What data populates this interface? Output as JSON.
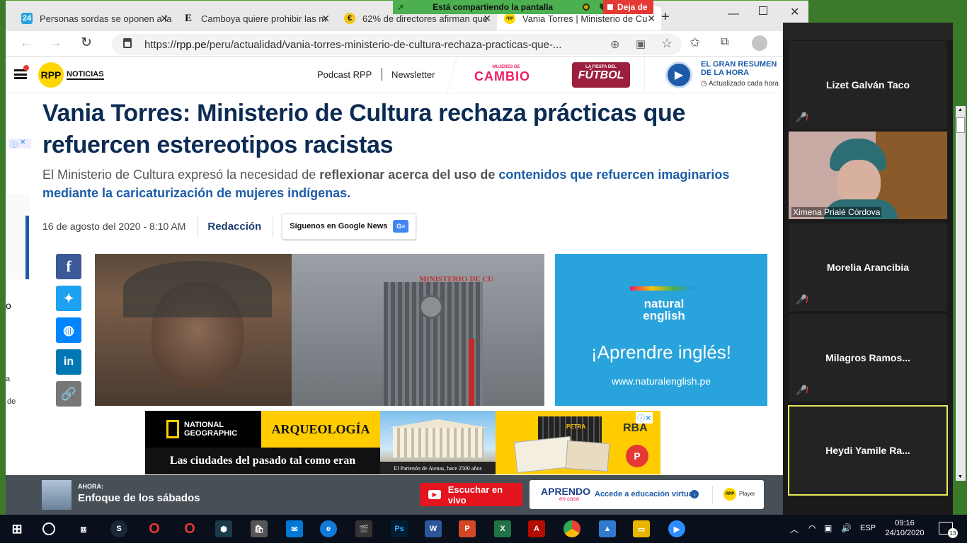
{
  "browser": {
    "tabs": [
      {
        "label": "Personas sordas se oponen a la",
        "favicon": "24"
      },
      {
        "label": "Camboya quiere prohibir las m",
        "favicon": "E"
      },
      {
        "label": "62% de directores afirman que",
        "favicon": "€"
      },
      {
        "label": "Vania Torres | Ministerio de Cu",
        "favicon": "rpp"
      }
    ],
    "url_prefix": "https://",
    "url_domain": "rpp.pe",
    "url_path": "/peru/actualidad/vania-torres-ministerio-de-cultura-rechaza-practicas-que-...",
    "share_banner": "Está compartiendo la pantalla",
    "stop_share": "Deja de"
  },
  "site": {
    "logo": "RPP",
    "logo_text": "NOTICIAS",
    "nav": [
      "Podcast RPP",
      "Newsletter"
    ],
    "brand_cambio_small": "MUJERES DE",
    "brand_cambio": "CAMBIO",
    "brand_futbol_small": "LA FIESTA DEL",
    "brand_futbol": "FÚTBOL",
    "resumen_title": "EL GRAN RESUMEN DE LA HORA",
    "resumen_sub": "Actualizado cada hora"
  },
  "article": {
    "title": "Vania Torres: Ministerio de Cultura rechaza prácticas que refuercen estereotipos racistas",
    "lead_1": "El Ministerio de Cultura expresó la necesidad de ",
    "lead_2": "reflexionar acerca del uso de",
    "lead_3": " ",
    "lead_4": "contenidos que refuercen imaginarios mediante la caricaturización de mujeres indígenas.",
    "date": "16 de agosto del 2020 - 8:10 AM",
    "author": "Redacción",
    "google_news": "Síguenos en Google News",
    "building_sign": "MINISTERIO DE CU"
  },
  "share_icons": [
    "facebook-icon",
    "twitter-icon",
    "messenger-icon",
    "linkedin-icon",
    "link-icon"
  ],
  "ads": {
    "ne_brand": "natural english",
    "ne_slogan": "¡Aprendre inglés!",
    "ne_url": "www.naturalenglish.pe",
    "ng_brand": "NATIONAL GEOGRAPHIC",
    "ng_title": "ARQUEOLOGÍA",
    "ng_tagline": "Las ciudades del pasado tal como eran",
    "ng_caption": "El Partenón de Atenas, hace 2500 años",
    "ng_rba": "RBA",
    "ng_petra": "PETRA"
  },
  "player": {
    "now_label": "AHORA:",
    "now_show": "Enfoque de los sábados",
    "listen_button": "Escuchar en vivo",
    "aprendo": "APRENDO",
    "aprendo_sub": "en casa",
    "aprendo_cta": "Accede a educación virtual",
    "rpp_player": "Player"
  },
  "zoom": {
    "participants": [
      {
        "name": "Lizet Galván Taco",
        "video": false
      },
      {
        "name": "Ximena Prialé Córdova",
        "video": true
      },
      {
        "name": "Morelia Arancibia",
        "video": false
      },
      {
        "name": "Milagros  Ramos...",
        "video": false
      },
      {
        "name": "Heydi  Yamile Ra...",
        "video": false
      }
    ]
  },
  "taskbar": {
    "lang": "ESP",
    "time": "09:16",
    "date": "24/10/2020",
    "notifications": "13"
  },
  "left_cut_text": [
    "o",
    "a",
    "de"
  ]
}
